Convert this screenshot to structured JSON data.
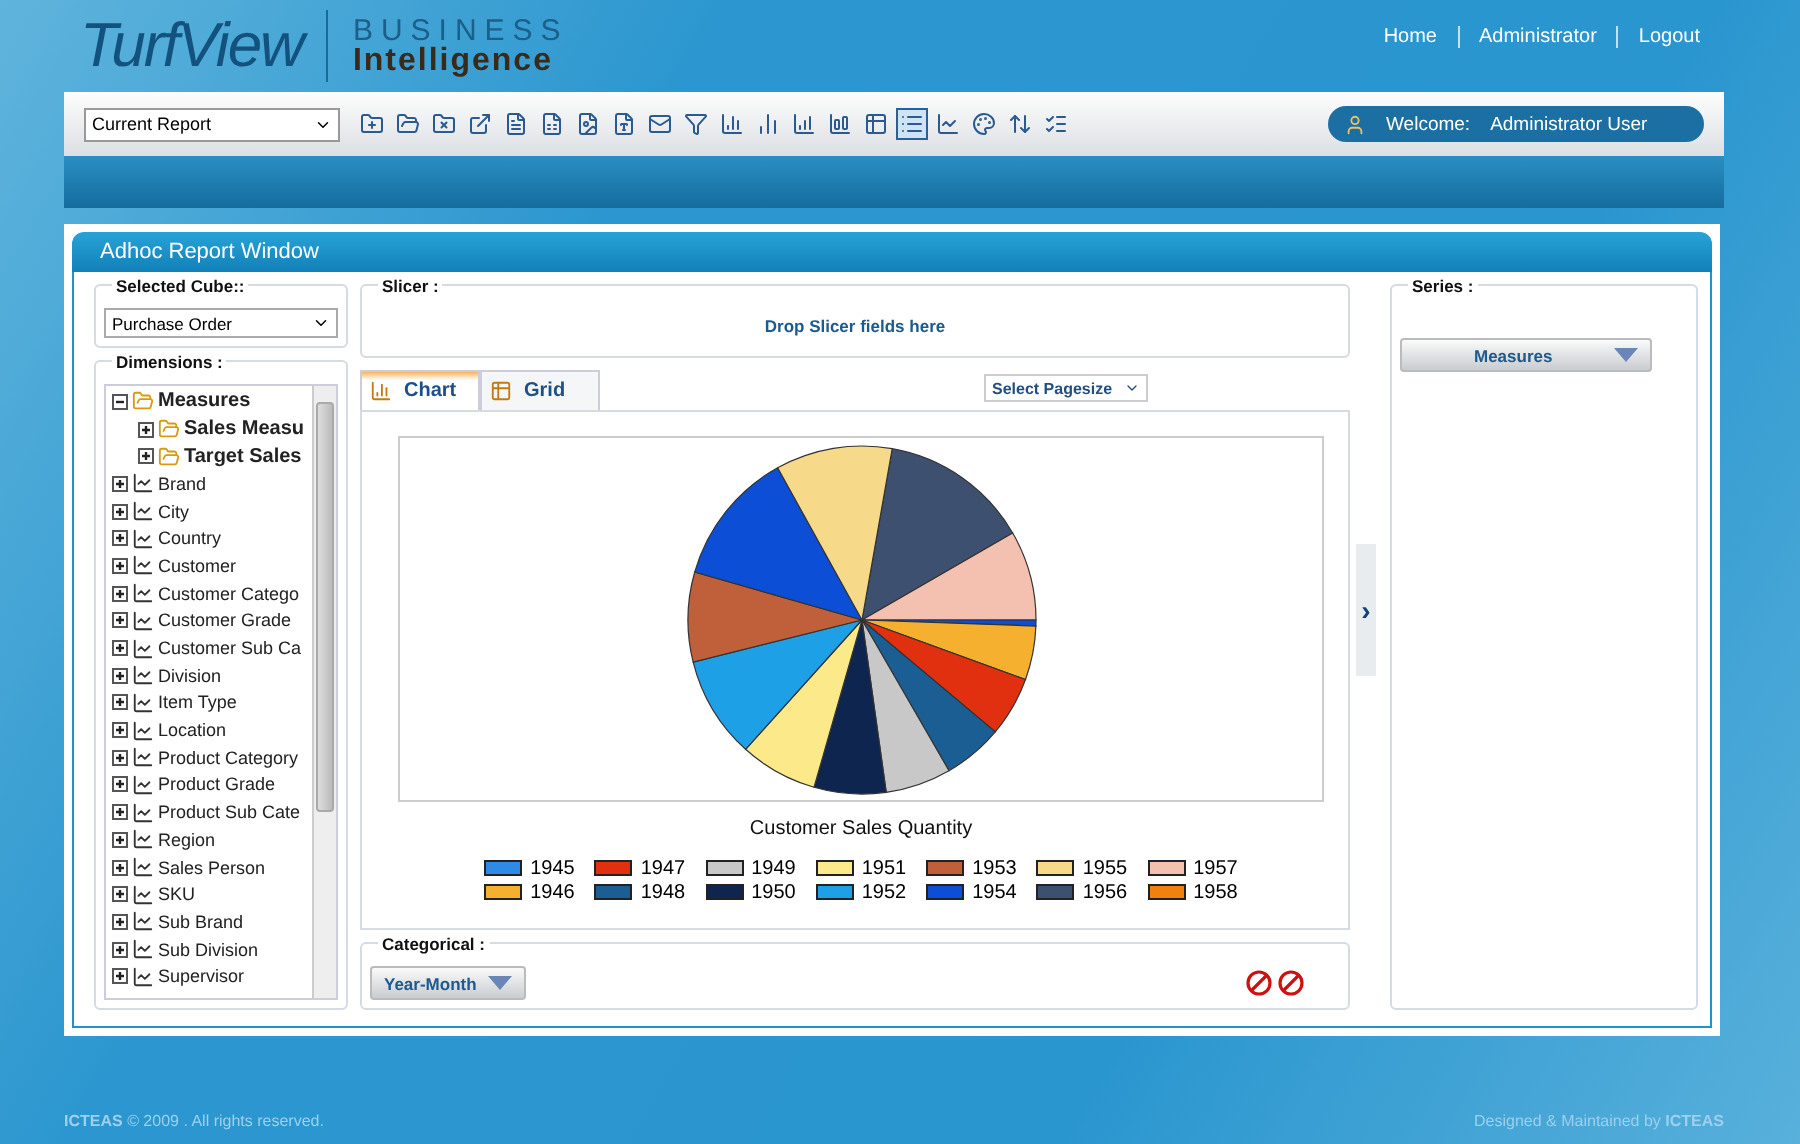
{
  "header": {
    "logo_main": "TurfView",
    "logo_top": "BUSINESS",
    "logo_bottom": "Intelligence",
    "nav": [
      "Home",
      "Administrator",
      "Logout"
    ]
  },
  "toolbar": {
    "report_select": "Current Report",
    "tools": [
      {
        "selected": false
      },
      {
        "selected": false
      },
      {
        "selected": false
      },
      {
        "selected": false
      },
      {
        "selected": false
      },
      {
        "selected": false
      },
      {
        "selected": false
      },
      {
        "selected": false
      },
      {
        "selected": false
      },
      {
        "selected": false
      },
      {
        "selected": false
      },
      {
        "selected": false
      },
      {
        "selected": false
      },
      {
        "selected": false
      },
      {
        "selected": false
      },
      {
        "selected": true
      },
      {
        "selected": false
      },
      {
        "selected": false
      },
      {
        "selected": false
      },
      {
        "selected": false
      }
    ],
    "welcome_label": "Welcome:",
    "user": "Administrator User"
  },
  "window": {
    "title": "Adhoc Report Window"
  },
  "cube": {
    "label": "Selected Cube::",
    "value": "Purchase Order"
  },
  "dimensions": {
    "label": "Dimensions :",
    "items": [
      {
        "label": "Measures",
        "kind": "measure",
        "expanded": true,
        "children": [
          {
            "label": "Sales Measu",
            "kind": "measure",
            "expanded": false
          },
          {
            "label": "Target Sales",
            "kind": "measure",
            "expanded": false
          }
        ]
      },
      {
        "label": "Brand",
        "kind": "dimension",
        "expanded": false
      },
      {
        "label": "City",
        "kind": "dimension",
        "expanded": false
      },
      {
        "label": "Country",
        "kind": "dimension",
        "expanded": false
      },
      {
        "label": "Customer",
        "kind": "dimension",
        "expanded": false
      },
      {
        "label": "Customer Catego",
        "kind": "dimension",
        "expanded": false
      },
      {
        "label": "Customer Grade",
        "kind": "dimension",
        "expanded": false
      },
      {
        "label": "Customer Sub Ca",
        "kind": "dimension",
        "expanded": false
      },
      {
        "label": "Division",
        "kind": "dimension",
        "expanded": false
      },
      {
        "label": "Item Type",
        "kind": "dimension",
        "expanded": false
      },
      {
        "label": "Location",
        "kind": "dimension",
        "expanded": false
      },
      {
        "label": "Product Category",
        "kind": "dimension",
        "expanded": false
      },
      {
        "label": "Product Grade",
        "kind": "dimension",
        "expanded": false
      },
      {
        "label": "Product Sub Cate",
        "kind": "dimension",
        "expanded": false
      },
      {
        "label": "Region",
        "kind": "dimension",
        "expanded": false
      },
      {
        "label": "Sales Person",
        "kind": "dimension",
        "expanded": false
      },
      {
        "label": "SKU",
        "kind": "dimension",
        "expanded": false
      },
      {
        "label": "Sub Brand",
        "kind": "dimension",
        "expanded": false
      },
      {
        "label": "Sub Division",
        "kind": "dimension",
        "expanded": false
      },
      {
        "label": "Supervisor",
        "kind": "dimension",
        "expanded": false
      }
    ]
  },
  "slicer": {
    "label": "Slicer :",
    "hint": "Drop Slicer fields here"
  },
  "tabs": [
    {
      "label": "Chart",
      "selected": true
    },
    {
      "label": "Grid",
      "selected": false
    }
  ],
  "pagesize": "Select Pagesize",
  "collapse_handle": "›",
  "chart": {
    "title": "Customer Sales Quantity",
    "legend": [
      {
        "label": "1945",
        "color": "#2f8ae6"
      },
      {
        "label": "1946",
        "color": "#f5b030"
      },
      {
        "label": "1947",
        "color": "#e03010"
      },
      {
        "label": "1948",
        "color": "#1b5e94"
      },
      {
        "label": "1949",
        "color": "#c8c8c8"
      },
      {
        "label": "1950",
        "color": "#0e2550"
      },
      {
        "label": "1951",
        "color": "#fbe98a"
      },
      {
        "label": "1952",
        "color": "#1ea0e6"
      },
      {
        "label": "1953",
        "color": "#c0603a"
      },
      {
        "label": "1954",
        "color": "#0d4ed6"
      },
      {
        "label": "1955",
        "color": "#f7d98a"
      },
      {
        "label": "1956",
        "color": "#3d5070"
      },
      {
        "label": "1957",
        "color": "#f4c0b0"
      },
      {
        "label": "1958",
        "color": "#f08010"
      }
    ]
  },
  "categorical": {
    "label": "Categorical :",
    "value": "Year-Month"
  },
  "series": {
    "label": "Series :",
    "value": "Measures"
  },
  "footer": {
    "left": "**ICTEAS** © 2009 . All rights reserved.",
    "right": "Designed & Maintained by **ICTEAS**"
  }
}
